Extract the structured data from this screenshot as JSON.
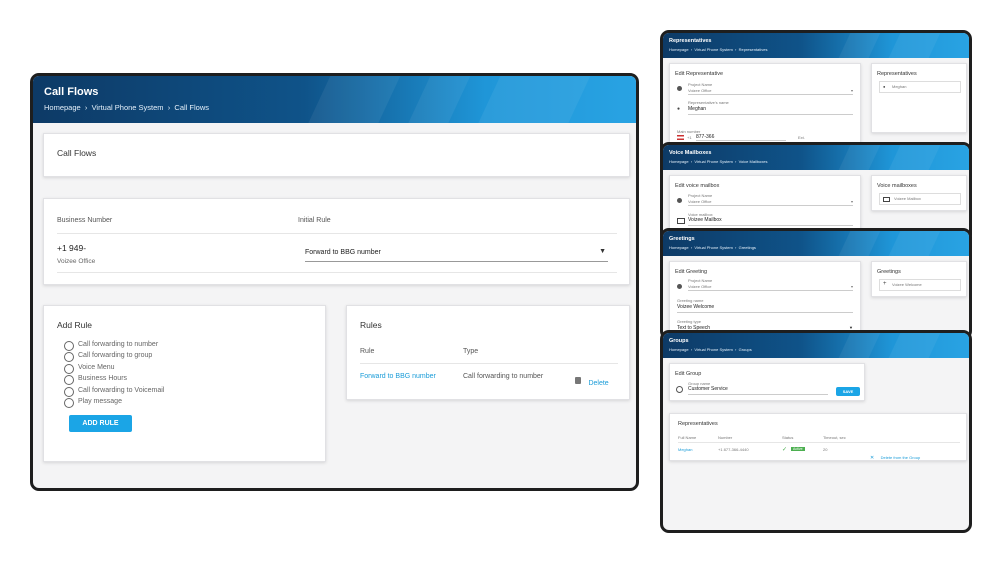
{
  "main": {
    "title": "Call Flows",
    "breadcrumb": [
      "Homepage",
      "Virtual Phone System",
      "Call Flows"
    ],
    "card_title": "Call Flows",
    "table": {
      "col_business": "Business Number",
      "col_rule": "Initial Rule",
      "number": "+1 949-",
      "office": "Voizee Office",
      "rule_select": "Forward to BBG number"
    },
    "add_rule": {
      "title": "Add Rule",
      "options": [
        "Call forwarding to number",
        "Call forwarding to group",
        "Voice Menu",
        "Business Hours",
        "Call forwarding to Voicemail",
        "Play message"
      ],
      "button": "ADD RULE"
    },
    "rules": {
      "title": "Rules",
      "col_rule": "Rule",
      "col_type": "Type",
      "row_rule": "Forward to BBG number",
      "row_type": "Call forwarding to number",
      "delete": "Delete"
    }
  },
  "reps": {
    "title": "Representatives",
    "breadcrumb": [
      "Homepage",
      "Virtual Phone System",
      "Representatives"
    ],
    "edit_title": "Edit Representative",
    "project_label": "Project Name",
    "project_value": "Voizee Office",
    "name_label": "Representative's name",
    "name_value": "Meghan",
    "phone_label": "Main number",
    "phone_prefix": "+1",
    "phone_value": "877-366",
    "ext_label": "Ext.",
    "side_title": "Representatives",
    "side_item": "Meghan"
  },
  "voice": {
    "title": "Voice Mailboxes",
    "breadcrumb": [
      "Homepage",
      "Virtual Phone System",
      "Voice Mailboxes"
    ],
    "edit_title": "Edit voice mailbox",
    "project_label": "Project Name",
    "project_value": "Voizee Office",
    "mailbox_label": "Voice mailbox",
    "mailbox_value": "Voizee Mailbox",
    "side_title": "Voice mailboxes",
    "side_item": "Voizee Mailbox"
  },
  "greet": {
    "title": "Greetings",
    "breadcrumb": [
      "Homepage",
      "Virtual Phone System",
      "Greetings"
    ],
    "edit_title": "Edit Greeting",
    "project_label": "Project Name",
    "project_value": "Voizee Office",
    "name_label": "Greeting name",
    "name_value": "Voizee Welcome",
    "type_label": "Greeting type",
    "type_value": "Text to Speech",
    "side_title": "Greetings",
    "side_item": "Voizee Welcome"
  },
  "groups": {
    "title": "Groups",
    "breadcrumb": [
      "Homepage",
      "Virtual Phone System",
      "Groups"
    ],
    "edit_title": "Edit Group",
    "group_label": "Group name",
    "group_value": "Customer Service",
    "save": "SAVE",
    "reps_title": "Representatives",
    "cols": [
      "Full Name",
      "Number",
      "Status",
      "Timeout, sec"
    ],
    "row": {
      "name": "Meghan",
      "number": "+1 877-366-4440",
      "status": "Active",
      "timeout": "20",
      "delete": "Delete from the Group"
    }
  },
  "colors": {
    "accent": "#1ba5e6",
    "banner_dark": "#0d3a66",
    "banner_light": "#29a3e3",
    "active": "#4caf50"
  }
}
